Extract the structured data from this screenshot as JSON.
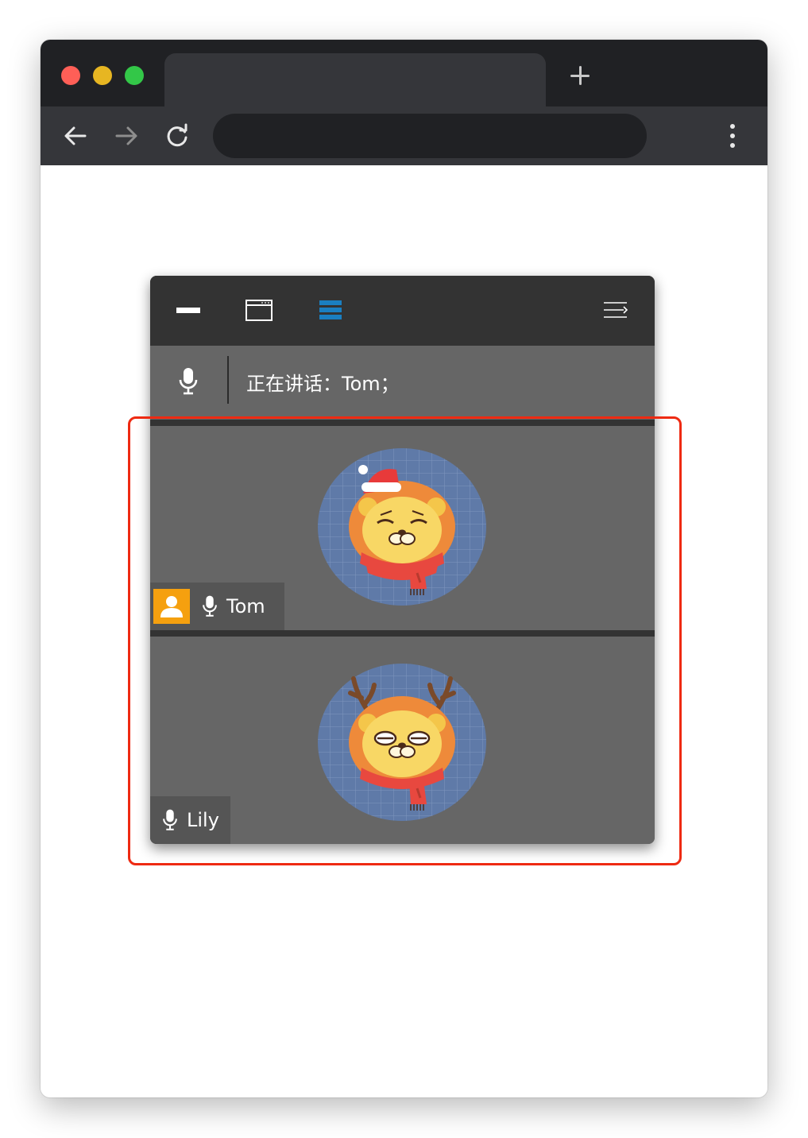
{
  "browser": {
    "traffic_lights": [
      {
        "name": "close",
        "color": "#ff5f57"
      },
      {
        "name": "minimize",
        "color": "#e7b622"
      },
      {
        "name": "maximize",
        "color": "#33c748"
      }
    ],
    "tab_title": "",
    "address_value": "",
    "icons": {
      "new_tab": "plus-icon",
      "back": "arrow-left-icon",
      "forward": "arrow-right-icon",
      "reload": "reload-icon",
      "menu": "vertical-dots-icon"
    }
  },
  "meeting": {
    "header_icons": [
      "minimize-icon",
      "window-icon",
      "list-view-icon",
      "collapse-menu-icon"
    ],
    "active_view_color": "#1a7fc1",
    "speaking_label": "正在讲话：",
    "speaking_names": "Tom；",
    "participants": [
      {
        "name": "Tom",
        "is_host": true,
        "avatar": "lion-santa-hat",
        "mic": "mic-icon"
      },
      {
        "name": "Lily",
        "is_host": false,
        "avatar": "lion-reindeer-antlers",
        "mic": "mic-icon"
      }
    ],
    "highlight_color": "#ee2a12"
  }
}
